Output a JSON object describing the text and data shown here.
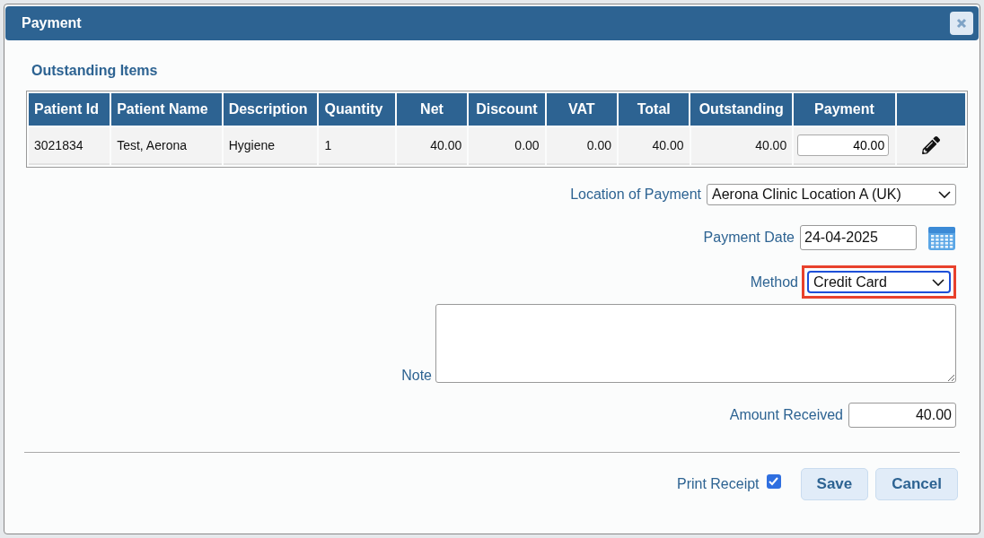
{
  "dialog": {
    "title": "Payment"
  },
  "section_title": "Outstanding Items",
  "table": {
    "columns": [
      "Patient Id",
      "Patient Name",
      "Description",
      "Quantity",
      "Net",
      "Discount",
      "VAT",
      "Total",
      "Outstanding",
      "Payment"
    ],
    "rows": [
      {
        "cells": [
          "3021834",
          "Test, Aerona",
          "Hygiene",
          "1",
          "40.00",
          "0.00",
          "0.00",
          "40.00",
          "40.00"
        ],
        "payment": "40.00"
      }
    ]
  },
  "form": {
    "location": {
      "label": "Location of Payment",
      "value": "Aerona Clinic Location A (UK)"
    },
    "payment_date": {
      "label": "Payment Date",
      "value": "24-04-2025"
    },
    "method": {
      "label": "Method",
      "value": "Credit Card",
      "highlighted": true
    },
    "note": {
      "label": "Note"
    },
    "amount_received": {
      "label": "Amount Received",
      "value": "40.00"
    }
  },
  "footer": {
    "print_receipt": {
      "label": "Print Receipt",
      "checked": true
    },
    "buttons": [
      "Save",
      "Cancel"
    ]
  }
}
